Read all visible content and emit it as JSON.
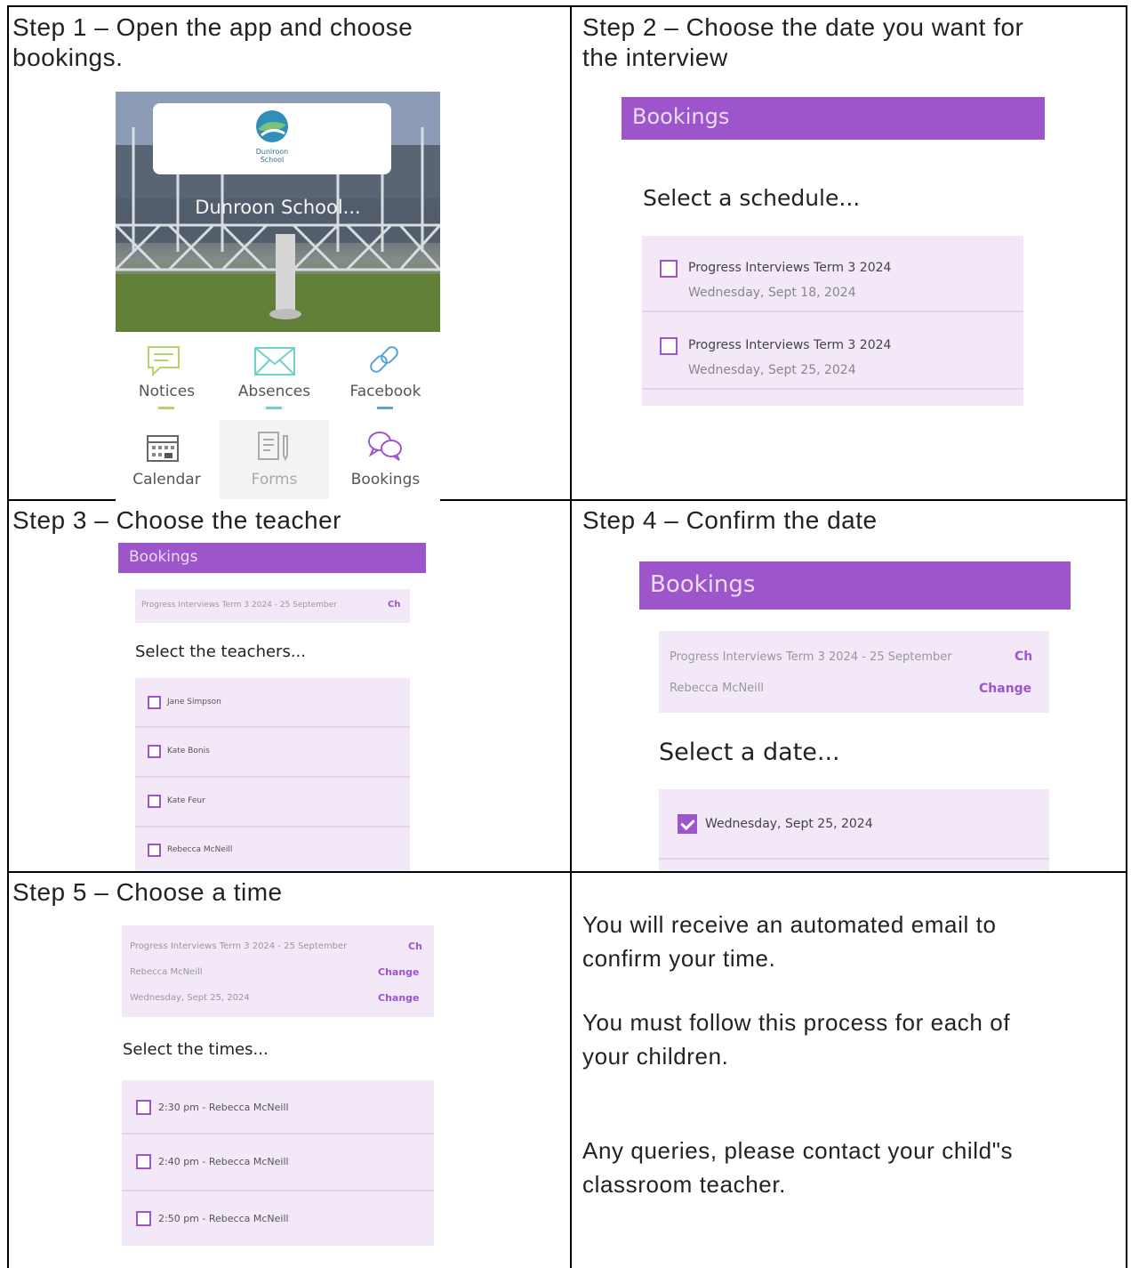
{
  "step1": {
    "title": "Step 1 – Open the app and choose bookings.",
    "title_line1": "Step 1 – Open the app and choose",
    "title_line2": "bookings.",
    "school_name": "Dunroon School...",
    "logo_text": "Dunlroon School",
    "tiles": [
      {
        "label": "Notices",
        "icon": "speech-bubble-icon",
        "color": "#b7d36b"
      },
      {
        "label": "Absences",
        "icon": "envelope-icon",
        "color": "#6fd1c9"
      },
      {
        "label": "Facebook",
        "icon": "link-icon",
        "color": "#5aa3d6"
      },
      {
        "label": "Calendar",
        "icon": "calendar-icon",
        "color": "#666666"
      },
      {
        "label": "Forms",
        "icon": "forms-icon",
        "color": "#aaaaaa"
      },
      {
        "label": "Bookings",
        "icon": "chat-bubbles-icon",
        "color": "#9d55cc"
      }
    ]
  },
  "step2": {
    "title_line1": "Step 2 – Choose the date you want for",
    "title_line2": "the interview",
    "header": "Bookings",
    "prompt": "Select a schedule...",
    "items": [
      {
        "title": "Progress Interviews Term 3 2024",
        "date": "Wednesday, Sept 18, 2024"
      },
      {
        "title": "Progress Interviews Term 3 2024",
        "date": "Wednesday, Sept 25, 2024"
      }
    ]
  },
  "step3": {
    "title": "Step 3 – Choose the teacher",
    "header": "Bookings",
    "summary": "Progress Interviews Term 3 2024 - 25 September",
    "summary_change": "Ch",
    "prompt": "Select the teachers...",
    "teachers": [
      "Jane Simpson",
      "Kate Bonis",
      "Kate Feur",
      "Rebecca McNeill"
    ]
  },
  "step4": {
    "title": "Step 4 – Confirm the date",
    "header": "Bookings",
    "summary": "Progress Interviews Term 3 2024 - 25 September",
    "summary_change": "Ch",
    "teacher": "Rebecca McNeill",
    "change": "Change",
    "prompt": "Select a date...",
    "date": "Wednesday, Sept 25, 2024"
  },
  "step5": {
    "title": "Step 5 – Choose a time",
    "summary": "Progress Interviews Term 3 2024 - 25 September",
    "summary_change": "Ch",
    "teacher": "Rebecca McNeill",
    "date": "Wednesday, Sept 25, 2024",
    "change": "Change",
    "prompt": "Select the times...",
    "times": [
      "2:30 pm - Rebecca McNeill",
      "2:40 pm - Rebecca McNeill",
      "2:50 pm - Rebecca McNeill"
    ]
  },
  "info": {
    "p1_line1": "You will receive an automated email to",
    "p1_line2": "confirm your time.",
    "p2_line1": "You must follow this process for each of",
    "p2_line2": "your children.",
    "p3_line1": "Any queries, please contact your child\"s",
    "p3_line2": "classroom teacher."
  },
  "colors": {
    "accent": "#9d55cc",
    "panel": "#f2e8f8",
    "border": "#000000"
  }
}
